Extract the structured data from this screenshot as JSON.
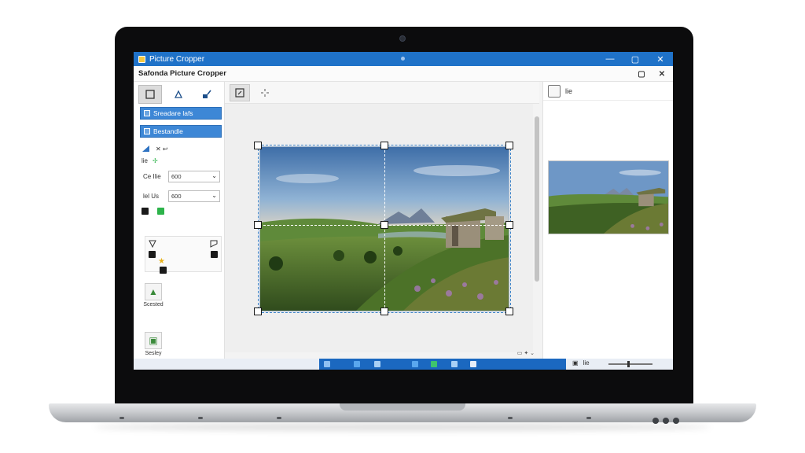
{
  "window": {
    "title": "Picture Cropper",
    "app_name": "Safonda Picture Cropper",
    "minimize": "—",
    "maximize": "▢",
    "close": "✕"
  },
  "left_panel": {
    "button_1": "Sreadare lafs",
    "button_2": "Bestandle",
    "misc_row": "✕ ↩",
    "misc_label": "lie",
    "fields": [
      {
        "label": "Ce Ilie",
        "value": "600"
      },
      {
        "label": "lel Us",
        "value": "600"
      }
    ],
    "tool_1_label": "Scested",
    "tool_2_label": "Sesley"
  },
  "right_panel": {
    "header_label": "lie"
  },
  "colors": {
    "titlebar": "#1f72c8",
    "accent_button": "#3d87d6",
    "crop_frame": "#3b82c8",
    "taskbar_strip": "#1b68c0"
  }
}
